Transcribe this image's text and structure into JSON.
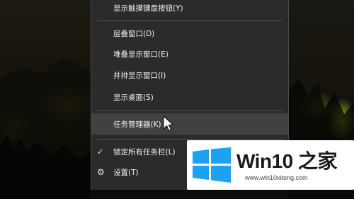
{
  "menu": {
    "items": [
      {
        "label": "显示触摸键盘按钮(Y)"
      },
      {
        "label": "层叠窗口(D)"
      },
      {
        "label": "堆叠显示窗口(E)"
      },
      {
        "label": "并排显示窗口(I)"
      },
      {
        "label": "显示桌面(S)"
      },
      {
        "label": "任务管理器(K)",
        "state": "hovered"
      },
      {
        "label": "锁定所有任务栏(L)",
        "checked": true,
        "icon": "check-icon"
      },
      {
        "label": "设置(T)",
        "icon": "gear-icon"
      }
    ]
  },
  "logo": {
    "title": "Win10 之家",
    "url": "www.win10xitong.com",
    "colors": {
      "flag": "#1da1f2",
      "text": "#1b1b1b"
    }
  },
  "colors": {
    "menu_background": "#2b2b2b",
    "hover_background": "#414141",
    "menu_text": "#f1f1f1"
  }
}
